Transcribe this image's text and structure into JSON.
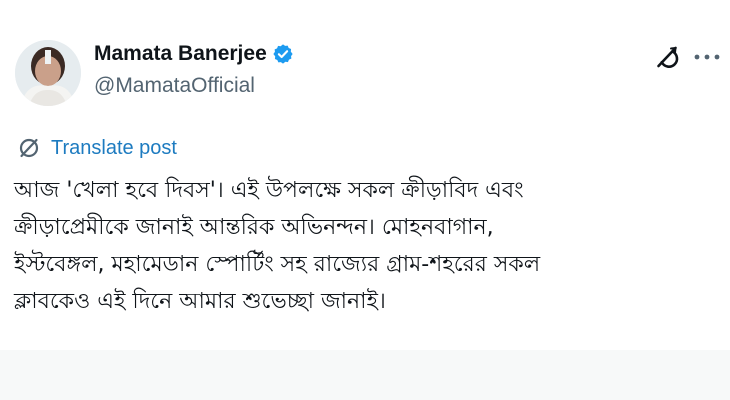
{
  "post": {
    "author": {
      "display_name": "Mamata Banerjee",
      "handle": "@MamataOfficial",
      "verified": true,
      "verified_color": "#1d9bf0"
    },
    "translate_label": "Translate post",
    "translate_color": "#1d7bc0",
    "text": "আজ 'খেলা হবে দিবস'। এই উপলক্ষে সকল ক্রীড়াবিদ এবং\nক্রীড়াপ্রেমীকে জানাই আন্তরিক অভিনন্দন। মোহনবাগান,\nইস্টবেঙ্গল, মহামেডান স্পোর্টিং সহ রাজ্যের গ্রাম-শহরের সকল\nক্লাবকেও এই দিনে আমার শুভেচ্ছা জানাই।",
    "icons": {
      "avatar": "profile-photo",
      "verified": "verified-badge-icon",
      "grok": "grok-icon",
      "more": "more-options-icon",
      "translate": "translate-icon"
    }
  }
}
